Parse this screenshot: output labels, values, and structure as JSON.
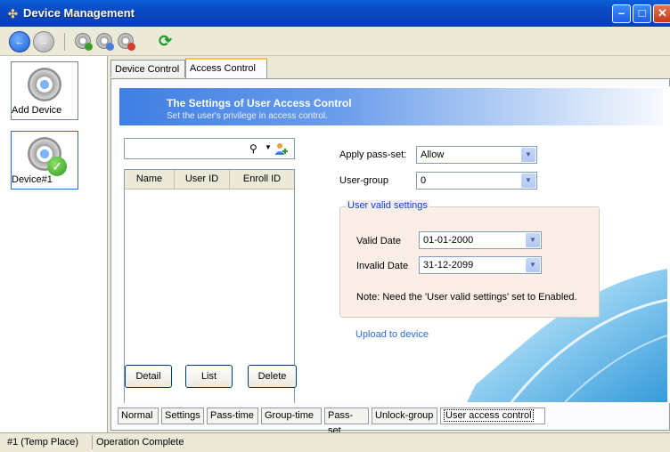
{
  "window": {
    "title": "Device Management"
  },
  "toolbar": {
    "icons": [
      "back-arrow-icon",
      "forward-arrow-icon",
      "gear-add-icon",
      "gear-search-icon",
      "gear-delete-icon",
      "refresh-icon"
    ]
  },
  "sidebar": {
    "add_device_label": "Add Device",
    "devices": [
      {
        "label": "Device#1"
      }
    ]
  },
  "top_tabs": [
    {
      "label": "Device Control",
      "active": false
    },
    {
      "label": "Access Control",
      "active": true
    }
  ],
  "banner": {
    "title": "The Settings of User Access Control",
    "subtitle": "Set the user's privilege in access control."
  },
  "search": {
    "value": "",
    "placeholder": ""
  },
  "user_list": {
    "columns": [
      "Name",
      "User ID",
      "Enroll ID"
    ],
    "rows": []
  },
  "list_buttons": {
    "detail": "Detail",
    "list": "List",
    "delete": "Delete"
  },
  "form": {
    "apply_pass_set_label": "Apply pass-set:",
    "apply_pass_set_value": "Allow",
    "user_group_label": "User-group",
    "user_group_value": "0",
    "valid_settings_title": "User valid settings",
    "valid_date_label": "Valid Date",
    "valid_date_value": "01-01-2000",
    "invalid_date_label": "Invalid Date",
    "invalid_date_value": "31-12-2099",
    "note": "Note: Need the 'User valid settings' set to Enabled.",
    "upload_link": "Upload to device"
  },
  "bottom_tabs": [
    {
      "label": "Normal",
      "active": false
    },
    {
      "label": "Settings",
      "active": false
    },
    {
      "label": "Pass-time",
      "active": false
    },
    {
      "label": "Group-time",
      "active": false
    },
    {
      "label": "Pass-set",
      "active": false
    },
    {
      "label": "Unlock-group",
      "active": false
    },
    {
      "label": "User access control",
      "active": true
    }
  ],
  "status": {
    "location": "#1 (Temp Place)",
    "message": "Operation Complete"
  },
  "colors": {
    "titlebar": "#0a49c3",
    "banner": "#3f7fe3",
    "group_bg": "#fbeee7",
    "link": "#2b6be0"
  }
}
